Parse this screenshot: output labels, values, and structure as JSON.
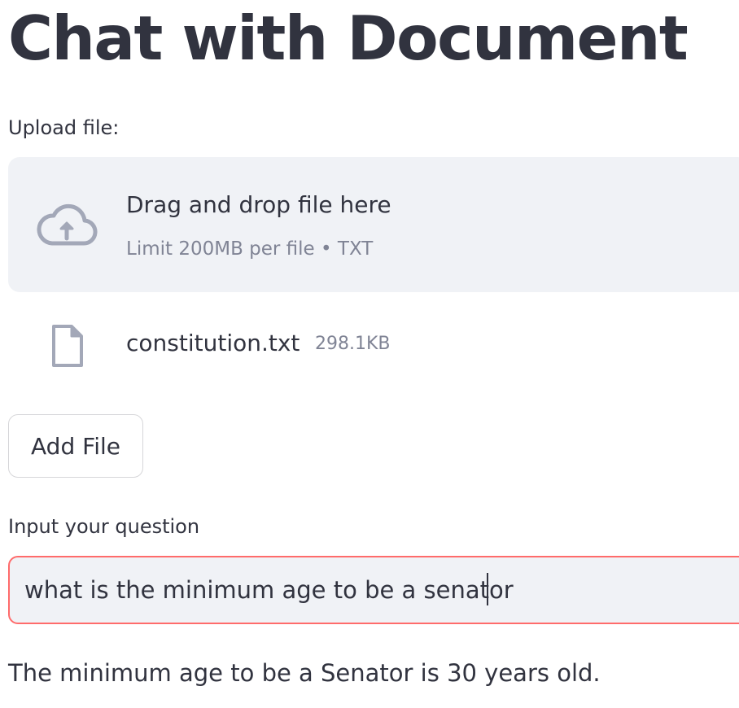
{
  "page": {
    "title": "Chat with Document"
  },
  "uploader": {
    "label": "Upload file:",
    "drop_title": "Drag and drop file here",
    "drop_limit": "Limit 200MB per file • TXT",
    "icon": "cloud-upload-icon"
  },
  "uploaded_file": {
    "name": "constitution.txt",
    "size": "298.1KB",
    "icon": "file-icon"
  },
  "actions": {
    "add_file_label": "Add File"
  },
  "question": {
    "label": "Input your question",
    "value": "what is the minimum age to be a senator"
  },
  "answer": {
    "text": "The minimum age to be a Senator is 30 years old."
  },
  "colors": {
    "text": "#31333f",
    "muted": "#808495",
    "surface": "#f0f2f6",
    "focus_border": "#ff6b6b"
  }
}
